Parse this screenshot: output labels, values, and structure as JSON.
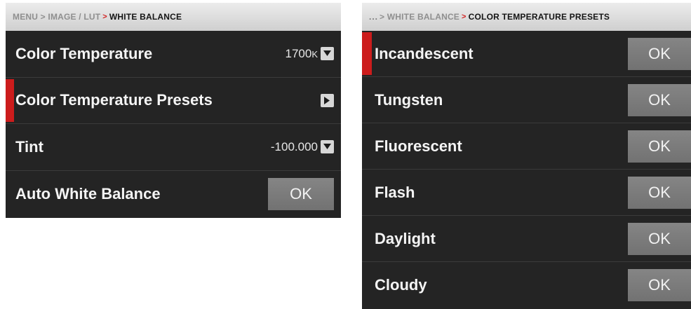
{
  "left": {
    "breadcrumb": {
      "path": "MENU > IMAGE / LUT",
      "arrow": ">",
      "current": "WHITE BALANCE"
    },
    "rows": [
      {
        "label": "Color Temperature",
        "value": "1700",
        "unit": "K"
      },
      {
        "label": "Color Temperature Presets"
      },
      {
        "label": "Tint",
        "value": "-100.000"
      },
      {
        "label": "Auto White Balance",
        "button": "OK"
      }
    ]
  },
  "right": {
    "breadcrumb": {
      "dots": "...",
      "path": "> WHITE BALANCE",
      "arrow": ">",
      "current": "COLOR TEMPERATURE PRESETS"
    },
    "rows": [
      {
        "label": "Incandescent",
        "button": "OK"
      },
      {
        "label": "Tungsten",
        "button": "OK"
      },
      {
        "label": "Fluorescent",
        "button": "OK"
      },
      {
        "label": "Flash",
        "button": "OK"
      },
      {
        "label": "Daylight",
        "button": "OK"
      },
      {
        "label": "Cloudy",
        "button": "OK"
      }
    ]
  },
  "colors": {
    "accent": "#cc1c1c",
    "panel": "#242424",
    "button": "#7a7a7a"
  },
  "icons": {
    "dropdown": "chevron-down-icon",
    "submenu": "chevron-right-icon"
  }
}
